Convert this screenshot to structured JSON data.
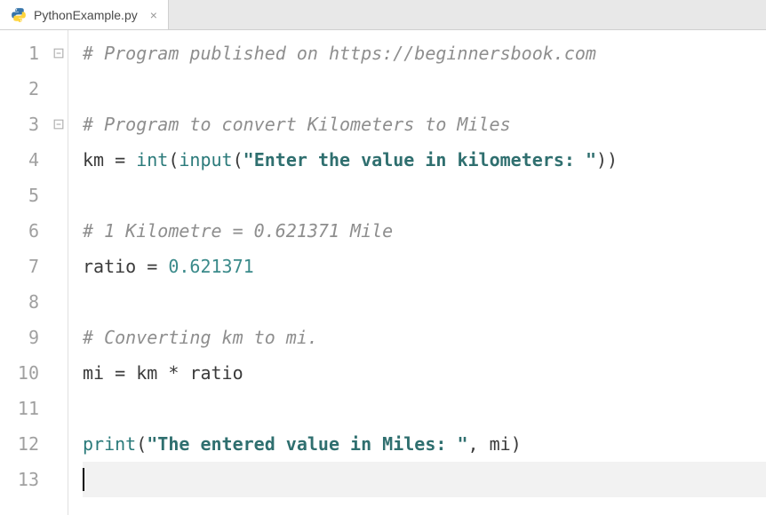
{
  "tab": {
    "filename": "PythonExample.py",
    "close_glyph": "×"
  },
  "gutter": {
    "lines": [
      "1",
      "2",
      "3",
      "4",
      "5",
      "6",
      "7",
      "8",
      "9",
      "10",
      "11",
      "12",
      "13"
    ]
  },
  "code": {
    "l1_comment": "# Program published on https://beginnersbook.com",
    "l3_comment": "# Program to convert Kilometers to Miles",
    "l4_km": "km ",
    "l4_eq": "= ",
    "l4_int": "int",
    "l4_p1": "(",
    "l4_input": "input",
    "l4_p2": "(",
    "l4_str": "\"Enter the value in kilometers: \"",
    "l4_p3": "))",
    "l6_comment": "# 1 Kilometre = 0.621371 Mile",
    "l7_ratio": "ratio ",
    "l7_eq": "= ",
    "l7_num": "0.621371",
    "l9_comment": "# Converting km to mi.",
    "l10_mi": "mi ",
    "l10_eq": "= ",
    "l10_km": "km ",
    "l10_star": "* ",
    "l10_ratio": "ratio",
    "l12_print": "print",
    "l12_p1": "(",
    "l12_str": "\"The entered value in Miles: \"",
    "l12_comma": ", ",
    "l12_mi": "mi",
    "l12_p2": ")"
  }
}
